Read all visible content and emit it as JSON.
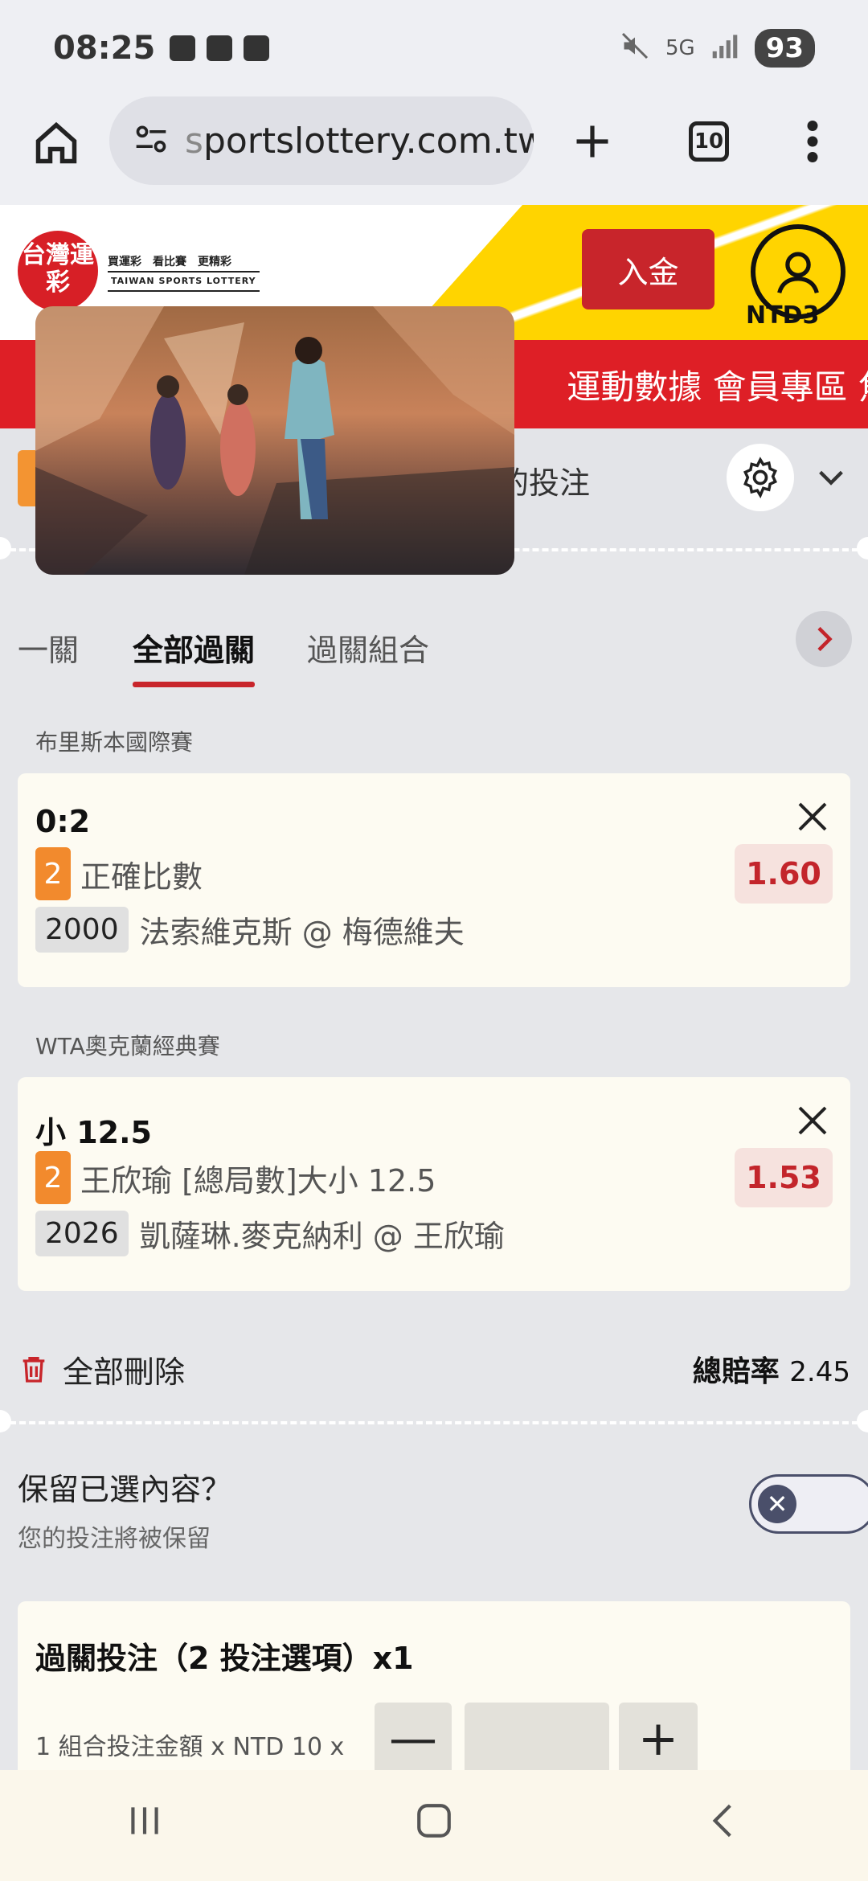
{
  "status_bar": {
    "time": "08:25",
    "network": "5G",
    "battery": "93"
  },
  "browser": {
    "url_prefix": "s",
    "url_main": "portslottery.com.tw",
    "tab_count": "10"
  },
  "header": {
    "logo_mark": "台灣運彩",
    "logo_line1": "買運彩　看比賽　更精彩",
    "logo_line2": "TAIWAN SPORTS LOTTERY",
    "deposit_label": "入金",
    "account_label": "NTD3",
    "nav_items": "運動數據 會員專區 焦"
  },
  "betslip": {
    "my_bets_label": "的投注",
    "tabs": [
      "一關",
      "全部過關",
      "過關組合"
    ],
    "selections": [
      {
        "league": "布里斯本國際賽",
        "pick": "0:2",
        "badge": "2",
        "market": "正確比數",
        "code": "2000",
        "match": "法索維克斯 @ 梅德維夫",
        "odds": "1.60"
      },
      {
        "league": "WTA奧克蘭經典賽",
        "pick": "小 12.5",
        "badge": "2",
        "market": "王欣瑜 [總局數]大小 12.5",
        "code": "2026",
        "match": "凱薩琳.麥克納利 @ 王欣瑜",
        "odds": "1.53"
      }
    ],
    "delete_all": "全部刪除",
    "total_odds_label": "總賠率",
    "total_odds": "2.45",
    "keep_title": "保留已選內容？",
    "keep_sub": "您的投注將被保留",
    "parlay_title": "過關投注（2 投注選項）x1",
    "parlay_line": "1 組合投注金額 x NTD 10 x",
    "minus": "—",
    "plus": "+"
  },
  "icons": {
    "home": "home-icon",
    "site_info": "site-settings-icon",
    "new_tab": "plus-icon",
    "tabs": "tabs-icon",
    "menu": "more-vert-icon"
  },
  "colors": {
    "brand_red": "#de1f26",
    "deposit_red": "#c8252b",
    "yellow": "#ffd400",
    "badge_orange": "#f28a2d"
  }
}
